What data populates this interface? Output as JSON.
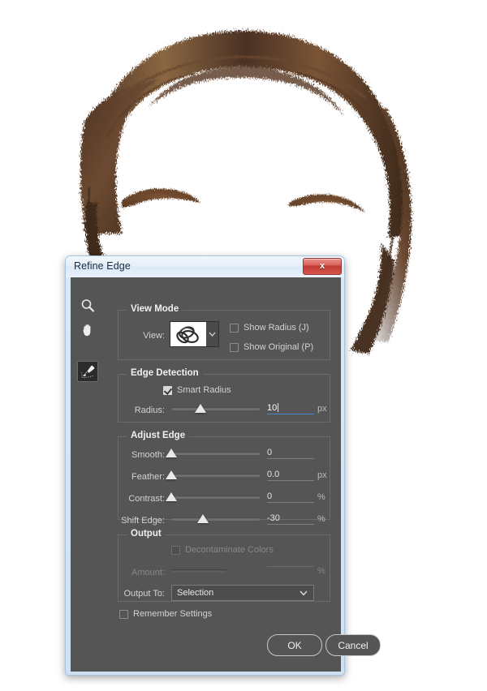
{
  "photo": {
    "alt_description": "hair-cutout-on-white"
  },
  "dialog": {
    "title": "Refine Edge",
    "close_label": "x",
    "tools": [
      {
        "name": "zoom-tool",
        "label": "Zoom Tool",
        "selected": false
      },
      {
        "name": "hand-tool",
        "label": "Hand Tool",
        "selected": false
      },
      {
        "name": "refine-radius-brush-tool",
        "label": "Refine Radius Tool",
        "selected": true
      }
    ],
    "view_mode": {
      "title": "View Mode",
      "view_label": "View:",
      "show_radius_label": "Show Radius (J)",
      "show_radius_checked": false,
      "show_original_label": "Show Original (P)",
      "show_original_checked": false
    },
    "edge_detection": {
      "title": "Edge Detection",
      "smart_radius_label": "Smart Radius",
      "smart_radius_checked": true,
      "radius_label": "Radius:",
      "radius_value": "10",
      "radius_unit": "px",
      "radius_slider_pct": 33
    },
    "adjust_edge": {
      "title": "Adjust Edge",
      "rows": [
        {
          "label": "Smooth:",
          "value": "0",
          "unit": "",
          "slider_pct": 0
        },
        {
          "label": "Feather:",
          "value": "0.0",
          "unit": "px",
          "slider_pct": 0
        },
        {
          "label": "Contrast:",
          "value": "0",
          "unit": "%",
          "slider_pct": 0
        },
        {
          "label": "Shift Edge:",
          "value": "-30",
          "unit": "%",
          "slider_pct": 35
        }
      ]
    },
    "output": {
      "title": "Output",
      "decontaminate_label": "Decontaminate Colors",
      "decontaminate_checked": false,
      "decontaminate_enabled": false,
      "amount_label": "Amount:",
      "amount_value": "",
      "amount_unit": "%",
      "amount_slider_pct": 62,
      "output_to_label": "Output To:",
      "output_to_value": "Selection"
    },
    "remember_settings_label": "Remember Settings",
    "remember_settings_checked": false,
    "ok_label": "OK",
    "cancel_label": "Cancel"
  }
}
